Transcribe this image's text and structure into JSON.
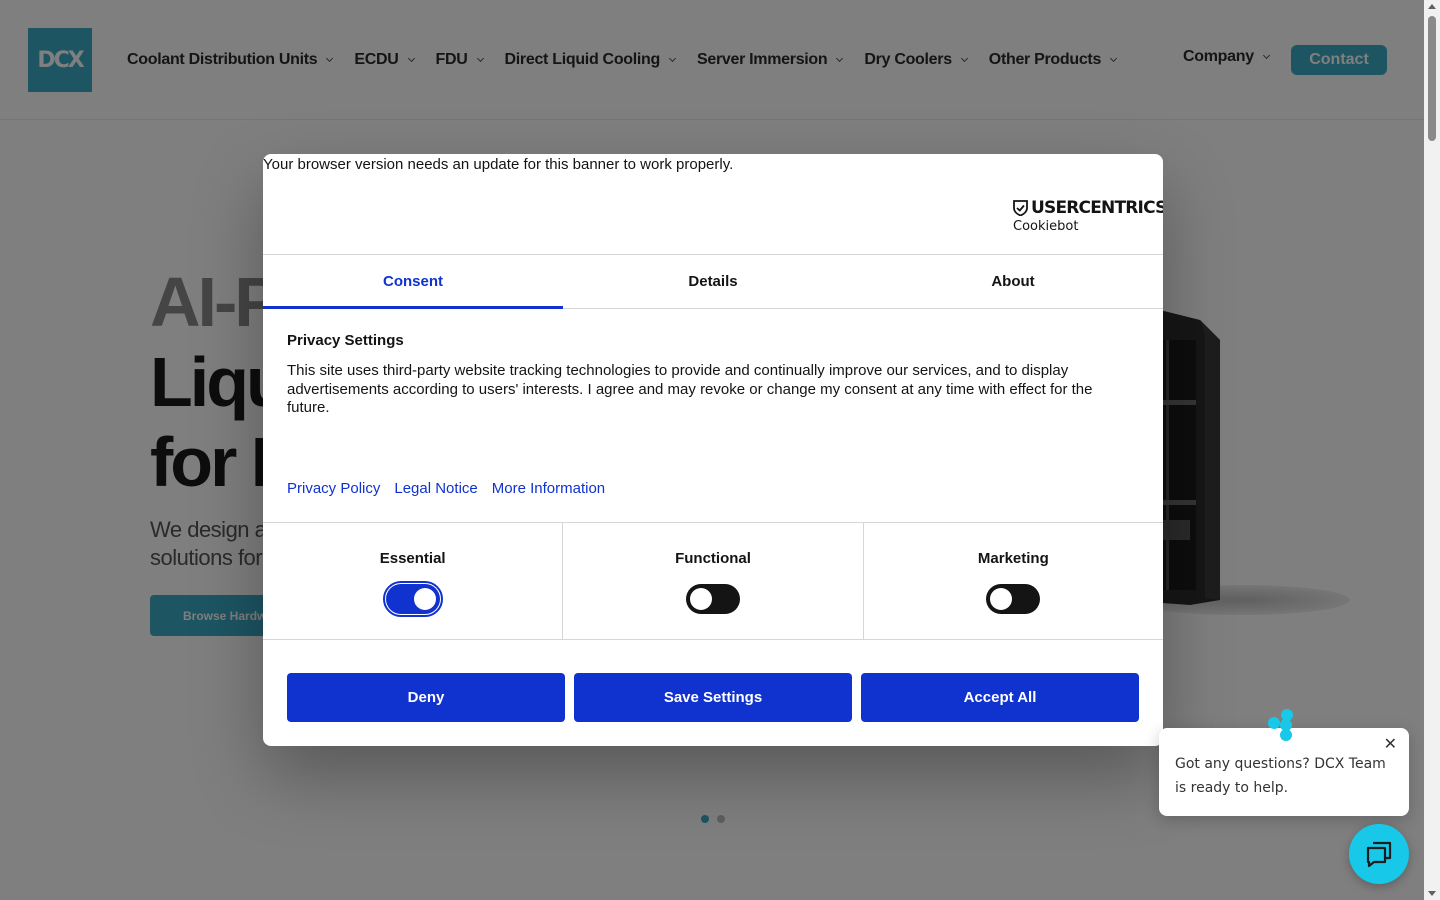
{
  "header": {
    "logo_text": "DCX",
    "nav": [
      {
        "label": "Coolant Distribution Units"
      },
      {
        "label": "ECDU"
      },
      {
        "label": "FDU"
      },
      {
        "label": "Direct Liquid Cooling"
      },
      {
        "label": "Server Immersion"
      },
      {
        "label": "Dry Coolers"
      },
      {
        "label": "Other Products"
      }
    ],
    "company_label": "Company",
    "contact_label": "Contact"
  },
  "hero": {
    "title_line1": "AI-P",
    "title_line2": "Liqu",
    "title_line3": "for D",
    "subtitle_line1": "We design a",
    "subtitle_line2": "solutions for",
    "button_label": "Browse Hardw",
    "slides": 2,
    "active_slide": 1
  },
  "cookie_dialog": {
    "warning": "Your browser version needs an update for this banner to work properly.",
    "brand_top": "USERCENTRICS",
    "brand_bottom": "Cookiebot",
    "tabs": [
      {
        "label": "Consent",
        "active": true
      },
      {
        "label": "Details",
        "active": false
      },
      {
        "label": "About",
        "active": false
      }
    ],
    "heading": "Privacy Settings",
    "body": "This site uses third-party website tracking technologies to provide and continually improve our services, and to display advertisements according to users' interests. I agree and may revoke or change my consent at any time with effect for the future.",
    "links": [
      "Privacy Policy",
      "Legal Notice",
      "More Information"
    ],
    "categories": [
      {
        "label": "Essential",
        "enabled": true
      },
      {
        "label": "Functional",
        "enabled": false
      },
      {
        "label": "Marketing",
        "enabled": false
      }
    ],
    "buttons": {
      "deny": "Deny",
      "save": "Save Settings",
      "accept": "Accept All"
    }
  },
  "chat": {
    "message": "Got any questions? DCX Team is ready to help.",
    "close_glyph": "✕"
  },
  "colors": {
    "accent": "#3aaac7",
    "dialog_blue": "#1032cf",
    "chat_cyan": "#18c8e8"
  }
}
